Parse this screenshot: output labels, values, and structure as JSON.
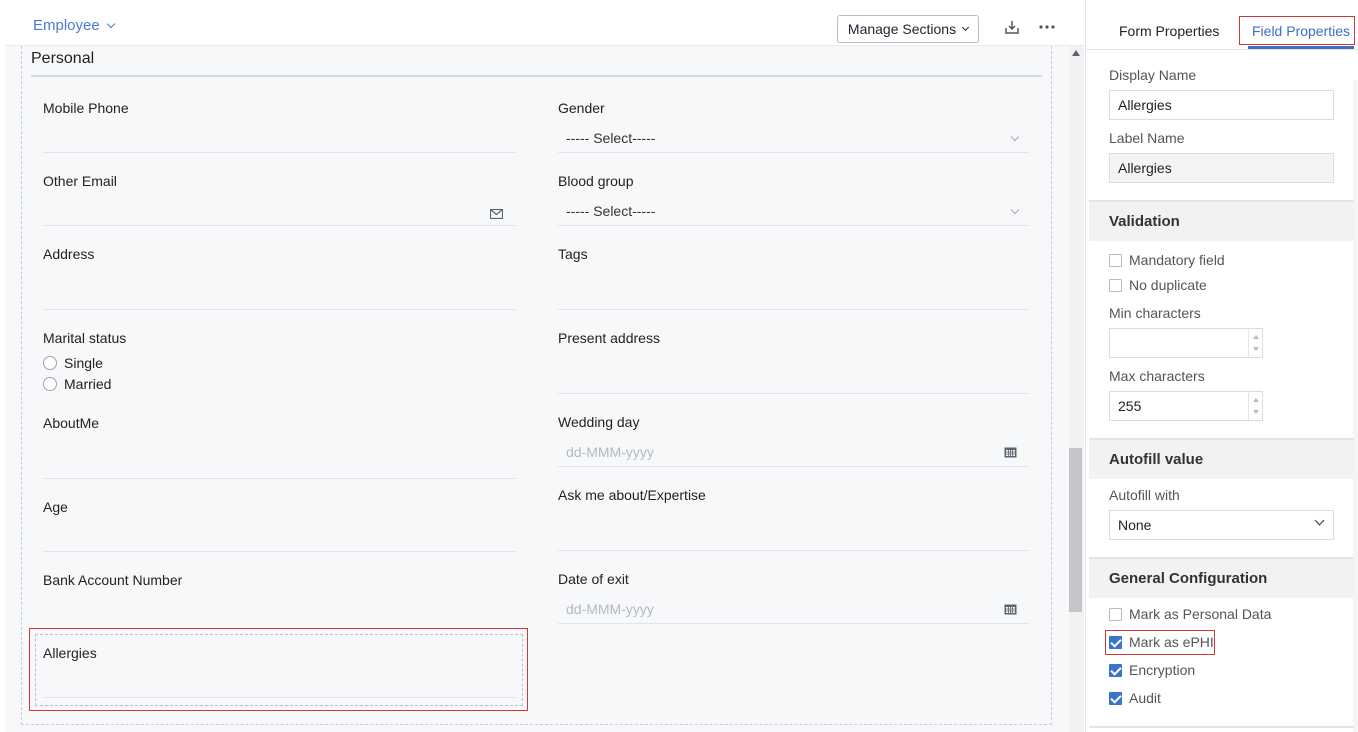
{
  "header": {
    "form_name": "Employee",
    "manage_sections_label": "Manage Sections",
    "download_icon": "download-icon",
    "more_icon": "more-horizontal-icon"
  },
  "section": {
    "title": "Personal"
  },
  "fields": {
    "mobile_phone": "Mobile Phone",
    "gender": "Gender",
    "gender_value": "----- Select-----",
    "other_email": "Other Email",
    "blood_group": "Blood group",
    "blood_group_value": "----- Select-----",
    "address": "Address",
    "tags": "Tags",
    "marital_status": "Marital status",
    "marital_options": [
      "Single",
      "Married"
    ],
    "present_address": "Present address",
    "about_me": "AboutMe",
    "wedding_day": "Wedding day",
    "wedding_day_placeholder": "dd-MMM-yyyy",
    "age": "Age",
    "expertise": "Ask me about/Expertise",
    "bank_account": "Bank Account Number",
    "date_of_exit": "Date of exit",
    "date_of_exit_placeholder": "dd-MMM-yyyy",
    "allergies": "Allergies"
  },
  "panel": {
    "tabs": {
      "form_properties": "Form Properties",
      "field_properties": "Field Properties"
    },
    "display_name_label": "Display Name",
    "display_name_value": "Allergies",
    "label_name_label": "Label Name",
    "label_name_value": "Allergies",
    "validation": {
      "title": "Validation",
      "mandatory": "Mandatory field",
      "no_duplicate": "No duplicate",
      "min_chars_label": "Min characters",
      "min_chars_value": "",
      "max_chars_label": "Max characters",
      "max_chars_value": "255"
    },
    "autofill": {
      "title": "Autofill value",
      "with_label": "Autofill with",
      "with_value": "None"
    },
    "general": {
      "title": "General Configuration",
      "personal_data": "Mark as Personal Data",
      "personal_data_checked": false,
      "ephi": "Mark as ePHI",
      "ephi_checked": true,
      "encryption": "Encryption",
      "encryption_checked": true,
      "audit": "Audit",
      "audit_checked": true
    }
  },
  "colors": {
    "accent": "#3d6fc4",
    "highlight": "#d03838",
    "checkbox": "#3a73c9"
  }
}
